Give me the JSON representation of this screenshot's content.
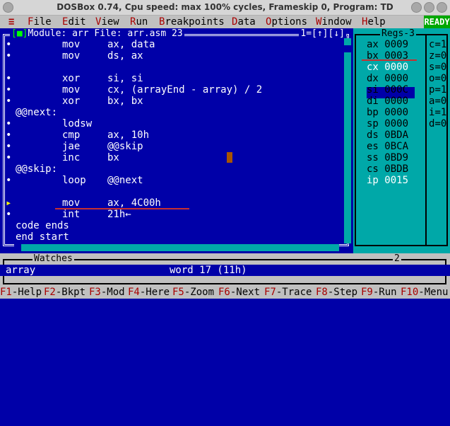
{
  "window": {
    "title": "DOSBox 0.74, Cpu speed: max 100% cycles, Frameskip  0, Program:      TD"
  },
  "menubar": {
    "system": "≡",
    "items": [
      {
        "hot": "F",
        "rest": "ile"
      },
      {
        "hot": "E",
        "rest": "dit"
      },
      {
        "hot": "V",
        "rest": "iew"
      },
      {
        "hot": "R",
        "rest": "un"
      },
      {
        "hot": "B",
        "rest": "reakpoints"
      },
      {
        "hot": "D",
        "rest": "ata"
      },
      {
        "hot": "O",
        "rest": "ptions"
      },
      {
        "hot": "W",
        "rest": "indow"
      },
      {
        "hot": "H",
        "rest": "elp"
      }
    ],
    "status": "READY"
  },
  "module": {
    "close_box": "[■]",
    "header": "Module: arr File: arr.asm 23",
    "header_right": "1=[↑][↓]",
    "lines": [
      {
        "mark": "•",
        "mn": "mov",
        "op": "ax, data"
      },
      {
        "mark": "•",
        "mn": "mov",
        "op": "ds, ax"
      },
      {
        "mark": "",
        "mn": "",
        "op": ""
      },
      {
        "mark": "•",
        "mn": "xor",
        "op": "si, si"
      },
      {
        "mark": "•",
        "mn": "mov",
        "op": "cx, (arrayEnd - array) / 2"
      },
      {
        "mark": "•",
        "mn": "xor",
        "op": "bx, bx"
      },
      {
        "mark": "",
        "label": "@@next:"
      },
      {
        "mark": "•",
        "mn": "lodsw",
        "op": ""
      },
      {
        "mark": "•",
        "mn": "cmp",
        "op": "ax, 10h"
      },
      {
        "mark": "•",
        "mn": "jae",
        "op": "@@skip"
      },
      {
        "mark": "•",
        "mn": "inc",
        "op": "bx"
      },
      {
        "mark": "",
        "label": "@@skip:"
      },
      {
        "mark": "•",
        "mn": "loop",
        "op": "@@next"
      },
      {
        "mark": "",
        "mn": "",
        "op": ""
      },
      {
        "mark": "▸",
        "mn": "mov",
        "op": "ax, 4C00h"
      },
      {
        "mark": "•",
        "mn": "int",
        "op": "21h←"
      },
      {
        "mark": "",
        "label": "code ends"
      },
      {
        "mark": "",
        "label": "end start"
      }
    ]
  },
  "regs": {
    "title": "Regs-3",
    "registers": [
      {
        "name": "ax",
        "value": "0009",
        "changed": false
      },
      {
        "name": "bx",
        "value": "0003",
        "changed": false
      },
      {
        "name": "cx",
        "value": "0000",
        "changed": true
      },
      {
        "name": "dx",
        "value": "0000",
        "changed": false
      },
      {
        "name": "si",
        "value": "000C",
        "changed": false
      },
      {
        "name": "di",
        "value": "0000",
        "changed": false
      },
      {
        "name": "bp",
        "value": "0000",
        "changed": false
      },
      {
        "name": "sp",
        "value": "0000",
        "changed": false
      },
      {
        "name": "ds",
        "value": "0BDA",
        "changed": false
      },
      {
        "name": "es",
        "value": "0BCA",
        "changed": false
      },
      {
        "name": "ss",
        "value": "0BD9",
        "changed": false
      },
      {
        "name": "cs",
        "value": "0BDB",
        "changed": false
      },
      {
        "name": "ip",
        "value": "0015",
        "changed": true
      }
    ],
    "flags": [
      {
        "name": "c",
        "value": "1"
      },
      {
        "name": "z",
        "value": "0"
      },
      {
        "name": "s",
        "value": "0"
      },
      {
        "name": "o",
        "value": "0"
      },
      {
        "name": "p",
        "value": "1"
      },
      {
        "name": "a",
        "value": "0"
      },
      {
        "name": "i",
        "value": "1"
      },
      {
        "name": "d",
        "value": "0"
      }
    ]
  },
  "watches": {
    "title": "Watches",
    "number": "2",
    "entries": [
      {
        "name": "array",
        "value": "word 17 (11h)"
      }
    ]
  },
  "fkeys": [
    {
      "key": "F1",
      "label": "-Help"
    },
    {
      "key": "F2",
      "label": "-Bkpt"
    },
    {
      "key": "F3",
      "label": "-Mod"
    },
    {
      "key": "F4",
      "label": "-Here"
    },
    {
      "key": "F5",
      "label": "-Zoom"
    },
    {
      "key": "F6",
      "label": "-Next"
    },
    {
      "key": "F7",
      "label": "-Trace"
    },
    {
      "key": "F8",
      "label": "-Step"
    },
    {
      "key": "F9",
      "label": "-Run"
    },
    {
      "key": "F10",
      "label": "-Menu"
    }
  ]
}
